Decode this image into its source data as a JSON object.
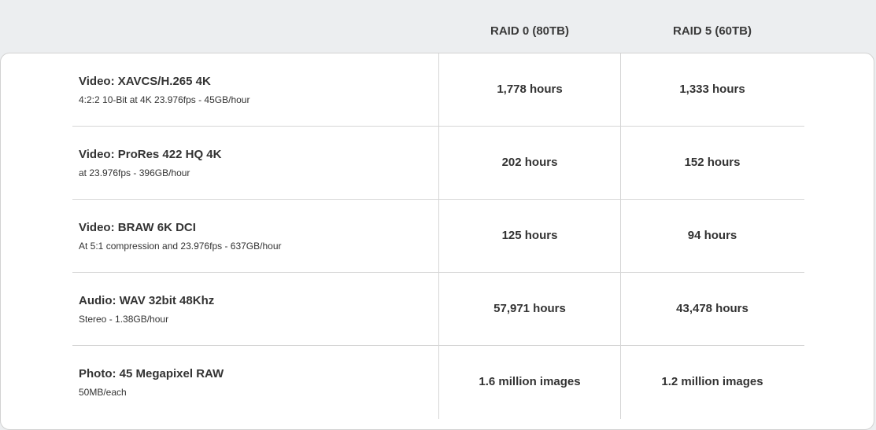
{
  "header": {
    "raid0_label": "RAID 0 (80TB)",
    "raid5_label": "RAID 5 (60TB)"
  },
  "rows": [
    {
      "title": "Video: XAVCS/H.265 4K",
      "subtitle": "4:2:2 10-Bit at 4K 23.976fps - 45GB/hour",
      "raid0": "1,778 hours",
      "raid5": "1,333 hours"
    },
    {
      "title": "Video: ProRes 422 HQ 4K",
      "subtitle": "at 23.976fps - 396GB/hour",
      "raid0": "202 hours",
      "raid5": "152 hours"
    },
    {
      "title": "Video: BRAW 6K DCI",
      "subtitle": "At 5:1 compression and 23.976fps - 637GB/hour",
      "raid0": "125 hours",
      "raid5": "94 hours"
    },
    {
      "title": "Audio: WAV 32bit 48Khz",
      "subtitle": "Stereo - 1.38GB/hour",
      "raid0": "57,971 hours",
      "raid5": "43,478 hours"
    },
    {
      "title": "Photo: 45 Megapixel RAW",
      "subtitle": "50MB/each",
      "raid0": "1.6 million images",
      "raid5": "1.2 million images"
    }
  ]
}
